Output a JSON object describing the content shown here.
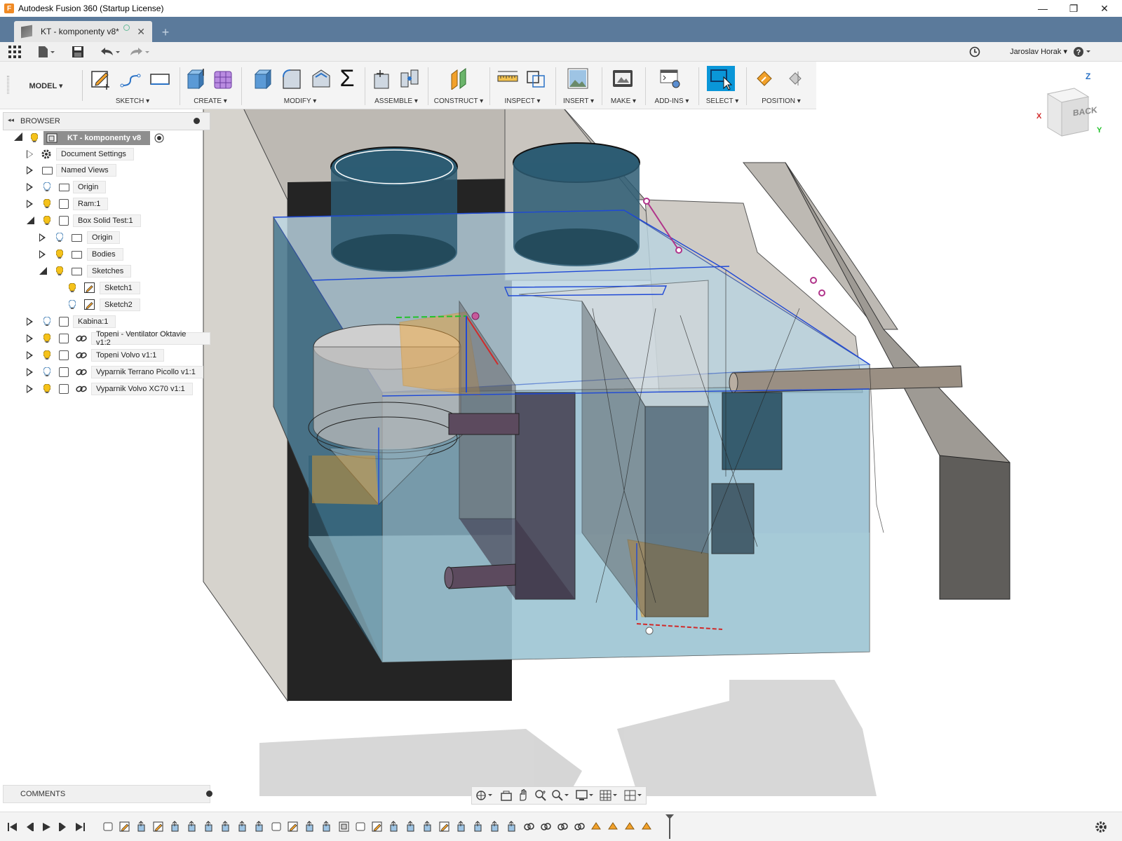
{
  "window": {
    "title": "Autodesk Fusion 360 (Startup License)",
    "logo_letter": "F",
    "minimize": "—",
    "restore": "❐",
    "close": "✕"
  },
  "tab": {
    "label": "KT - komponenty v8*",
    "close": "✕",
    "new_tab": "+"
  },
  "quick_access": {
    "user": "Jaroslav Horak ▾",
    "help": "?"
  },
  "toolbar": {
    "workspace": "MODEL ▾",
    "groups": [
      {
        "label": "SKETCH ▾"
      },
      {
        "label": "CREATE ▾"
      },
      {
        "label": "MODIFY ▾"
      },
      {
        "label": "ASSEMBLE ▾"
      },
      {
        "label": "CONSTRUCT ▾"
      },
      {
        "label": "INSPECT ▾"
      },
      {
        "label": "INSERT ▾"
      },
      {
        "label": "MAKE ▾"
      },
      {
        "label": "ADD-INS ▾"
      },
      {
        "label": "SELECT ▾"
      },
      {
        "label": "POSITION ▾"
      }
    ],
    "sum_symbol": "Σ"
  },
  "browser": {
    "title": "BROWSER",
    "collapse": "◂◂",
    "items": [
      {
        "label": "KT - komponenty v8"
      },
      {
        "label": "Document Settings"
      },
      {
        "label": "Named Views"
      },
      {
        "label": "Origin"
      },
      {
        "label": "Ram:1"
      },
      {
        "label": "Box Solid Test:1"
      },
      {
        "label": "Origin"
      },
      {
        "label": "Bodies"
      },
      {
        "label": "Sketches"
      },
      {
        "label": "Sketch1"
      },
      {
        "label": "Sketch2"
      },
      {
        "label": "Kabina:1"
      },
      {
        "label": "Topeni - Ventilator Oktavie v1:2"
      },
      {
        "label": "Topeni Volvo v1:1"
      },
      {
        "label": "Vyparnik Terrano Picollo v1:1"
      },
      {
        "label": "Vyparnik Volvo XC70 v1:1"
      }
    ]
  },
  "comments": {
    "title": "COMMENTS"
  },
  "viewcube": {
    "face": "BACK",
    "axis_z": "Z",
    "axis_x": "X",
    "axis_y": "Y"
  },
  "colors": {
    "tabbar": "#5b7a9b",
    "select_active": "#0a96d8",
    "bulb": "#f5c21b",
    "bulb_off": "#7fb2d9"
  }
}
